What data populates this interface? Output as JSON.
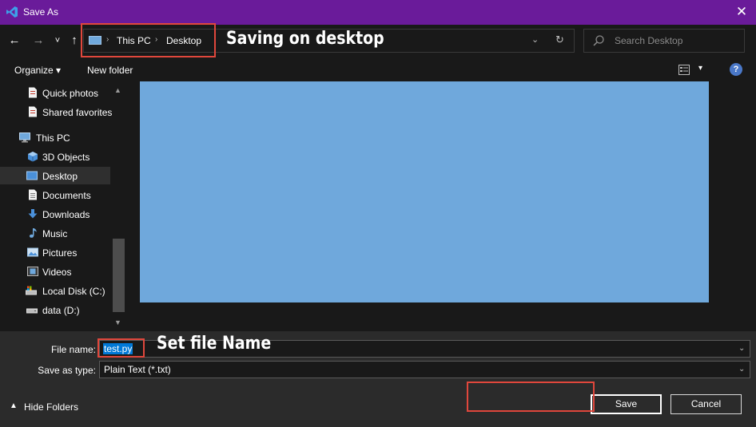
{
  "window": {
    "title": "Save As",
    "close_glyph": "✕",
    "accent_color": "#6a1b9a"
  },
  "nav_buttons": {
    "back_glyph": "←",
    "forward_glyph": "→",
    "recent_glyph": "˅",
    "up_glyph": "↑"
  },
  "address": {
    "separator": "›",
    "crumbs": [
      "This PC",
      "Desktop"
    ],
    "dropdown_glyph": "⌄",
    "refresh_glyph": "↻"
  },
  "search": {
    "placeholder": "Search Desktop",
    "icon": "search-icon"
  },
  "toolbar": {
    "organize_label": "Organize ▾",
    "new_folder_label": "New folder",
    "view_dropdown_glyph": "▾",
    "help_glyph": "?"
  },
  "sidebar": {
    "items": [
      {
        "label": "Quick photos",
        "icon": "document-icon",
        "selected": false
      },
      {
        "label": "Shared favorites",
        "icon": "document-icon",
        "selected": false
      },
      {
        "label": "This PC",
        "icon": "computer-icon",
        "selected": false
      },
      {
        "label": "3D Objects",
        "icon": "cube-icon",
        "selected": false
      },
      {
        "label": "Desktop",
        "icon": "desktop-icon",
        "selected": true
      },
      {
        "label": "Documents",
        "icon": "document-icon",
        "selected": false
      },
      {
        "label": "Downloads",
        "icon": "download-icon",
        "selected": false
      },
      {
        "label": "Music",
        "icon": "music-icon",
        "selected": false
      },
      {
        "label": "Pictures",
        "icon": "pictures-icon",
        "selected": false
      },
      {
        "label": "Videos",
        "icon": "video-icon",
        "selected": false
      },
      {
        "label": "Local Disk (C:)",
        "icon": "drive-icon",
        "selected": false
      },
      {
        "label": "data (D:)",
        "icon": "drive-icon",
        "selected": false
      }
    ],
    "scroll_up_glyph": "▲",
    "scroll_down_glyph": "▼"
  },
  "content": {
    "fill_color": "#6fa8dc"
  },
  "form": {
    "file_name_label": "File name:",
    "file_name_value": "test.py",
    "save_as_type_label": "Save as type:",
    "save_as_type_value": "Plain Text (*.txt)",
    "dropdown_glyph": "⌄"
  },
  "footer": {
    "hide_folders_glyph": "▲",
    "hide_folders_label": "Hide Folders",
    "save_label": "Save",
    "cancel_label": "Cancel"
  },
  "annotations": {
    "address_note": "Saving on desktop",
    "filename_note": "Set file Name",
    "box_color": "#e0473c"
  }
}
